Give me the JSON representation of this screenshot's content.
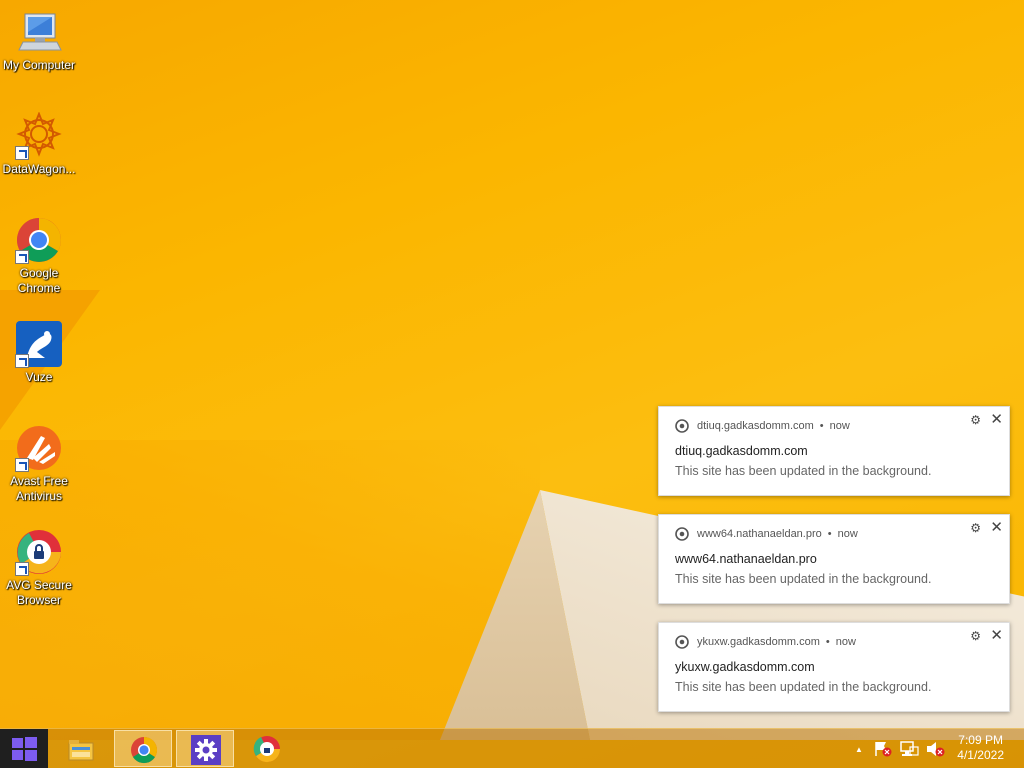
{
  "desktop": {
    "icons": [
      {
        "label": "My Computer"
      },
      {
        "label": "DataWagon..."
      },
      {
        "label": "Google Chrome"
      },
      {
        "label": "Vuze"
      },
      {
        "label": "Avast Free Antivirus"
      },
      {
        "label": "AVG Secure Browser"
      }
    ]
  },
  "notifications": [
    {
      "site": "dtiuq.gadkasdomm.com",
      "time": "now",
      "title": "dtiuq.gadkasdomm.com",
      "body": "This site has been updated in the background."
    },
    {
      "site": "www64.nathanaeldan.pro",
      "time": "now",
      "title": "www64.nathanaeldan.pro",
      "body": "This site has been updated in the background."
    },
    {
      "site": "ykuxw.gadkasdomm.com",
      "time": "now",
      "title": "ykuxw.gadkasdomm.com",
      "body": "This site has been updated in the background."
    }
  ],
  "notification_separator": "•",
  "taskbar": {
    "apps": [
      {
        "icon": "file-explorer-icon"
      },
      {
        "icon": "chrome-icon"
      },
      {
        "icon": "settings-gear-icon"
      },
      {
        "icon": "avg-browser-icon"
      }
    ],
    "tray": {
      "chevron": "▲",
      "icons": [
        "action-center-flag-icon",
        "network-icon",
        "volume-muted-icon"
      ]
    },
    "clock": {
      "time": "7:09 PM",
      "date": "4/1/2022"
    }
  },
  "colors": {
    "wallpaper": "#fbb600",
    "start_button": "#1f1f1f",
    "windows_logo": "#7d5cf0"
  }
}
